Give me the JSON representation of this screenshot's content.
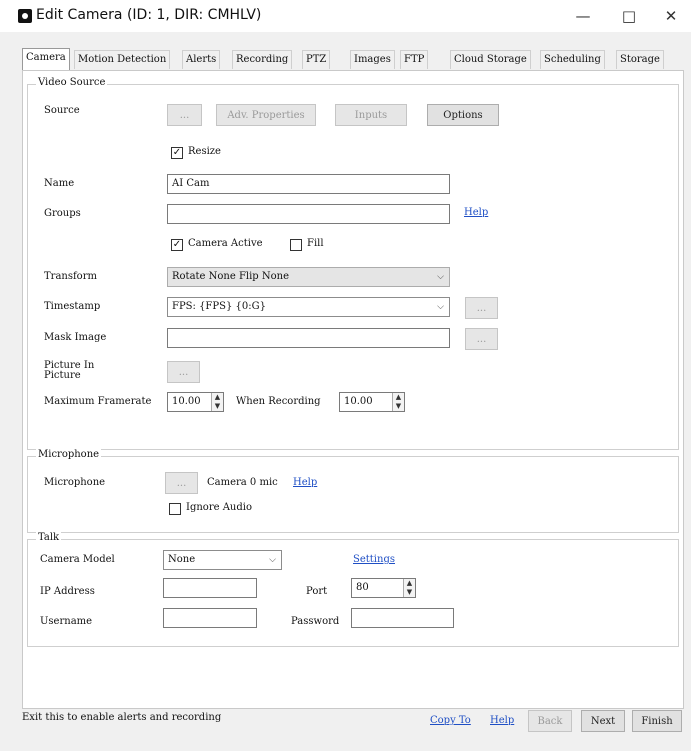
{
  "window": {
    "title": "Edit Camera (ID: 1, DIR: CMHLV)"
  },
  "tabs": [
    "Camera",
    "Motion Detection",
    "Alerts",
    "Recording",
    "PTZ",
    "Images",
    "FTP",
    "Cloud Storage",
    "Scheduling",
    "Storage"
  ],
  "video_source": {
    "legend": "Video Source",
    "source_label": "Source",
    "source_browse": "...",
    "adv_properties": "Adv. Properties",
    "inputs": "Inputs",
    "options": "Options",
    "resize_label": "Resize",
    "resize_checked": true,
    "name_label": "Name",
    "name_value": "AI Cam",
    "groups_label": "Groups",
    "groups_value": "",
    "help": "Help",
    "camera_active_label": "Camera Active",
    "camera_active_checked": true,
    "fill_label": "Fill",
    "fill_checked": false,
    "transform_label": "Transform",
    "transform_value": "Rotate None Flip None",
    "timestamp_label": "Timestamp",
    "timestamp_value": "FPS: {FPS} {0:G}",
    "timestamp_browse": "...",
    "mask_label": "Mask Image",
    "mask_value": "",
    "mask_browse": "...",
    "pip_label": "Picture In Picture",
    "pip_browse": "...",
    "max_framerate_label": "Maximum Framerate",
    "max_framerate_value": "10.00",
    "when_recording_label": "When Recording",
    "when_recording_value": "10.00"
  },
  "microphone": {
    "legend": "Microphone",
    "label": "Microphone",
    "browse": "...",
    "device": "Camera 0 mic",
    "help": "Help",
    "ignore_audio_label": "Ignore Audio",
    "ignore_audio_checked": false
  },
  "talk": {
    "legend": "Talk",
    "camera_model_label": "Camera Model",
    "camera_model_value": "None",
    "settings": "Settings",
    "ip_label": "IP Address",
    "ip_value": "",
    "port_label": "Port",
    "port_value": "80",
    "username_label": "Username",
    "username_value": "",
    "password_label": "Password",
    "password_value": ""
  },
  "footer": {
    "message": "Exit this to enable alerts and recording",
    "copy_to": "Copy To",
    "help": "Help",
    "back": "Back",
    "next": "Next",
    "finish": "Finish"
  },
  "colors": {
    "link": "#1f4fc5",
    "panel_bg": "#ffffff",
    "window_bg": "#f0f0f0"
  },
  "icons": {
    "window_buttons": [
      "minimize-icon",
      "maximize-icon",
      "close-icon"
    ],
    "spinner": "spinner-arrows-icon"
  }
}
